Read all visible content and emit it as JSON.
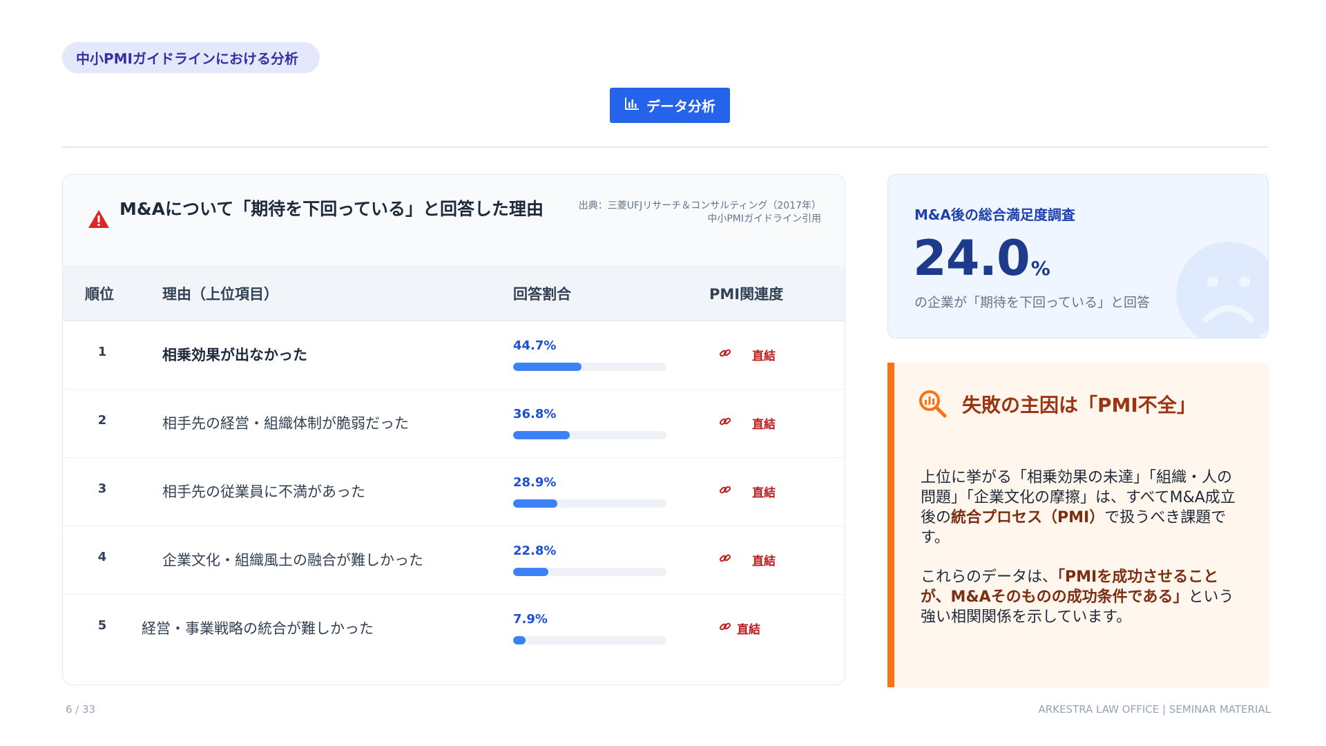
{
  "header": {
    "pill_label": "中小PMIガイドラインにおける分析",
    "badge_label": "データ分析",
    "badge_icon": "bar-chart-icon"
  },
  "table_card": {
    "title": "M&Aについて「期待を下回っている」と回答した理由",
    "source_line1": "出典：三菱UFJリサーチ＆コンサルティング（2017年）",
    "source_line2": "中小PMIガイドライン引用",
    "columns": [
      "順位",
      "理由（上位項目）",
      "回答割合",
      "PMI関連度"
    ],
    "rows": [
      {
        "rank": "1",
        "reason": "相乗効果が出なかった",
        "percent_label": "44.7%",
        "percent": 44.7,
        "relation": "直結"
      },
      {
        "rank": "2",
        "reason": "相手先の経営・組織体制が脆弱だった",
        "percent_label": "36.8%",
        "percent": 36.8,
        "relation": "直結"
      },
      {
        "rank": "3",
        "reason": "相手先の従業員に不満があった",
        "percent_label": "28.9%",
        "percent": 28.9,
        "relation": "直結"
      },
      {
        "rank": "4",
        "reason": "企業文化・組織風土の融合が難しかった",
        "percent_label": "22.8%",
        "percent": 22.8,
        "relation": "直結"
      },
      {
        "rank": "5",
        "reason": "経営・事業戦略の統合が難しかった",
        "percent_label": "7.9%",
        "percent": 7.9,
        "relation": "直結"
      }
    ]
  },
  "satisfaction": {
    "title": "M&A後の総合満足度調査",
    "value": "24.0",
    "unit": "%",
    "note": "の企業が「期待を下回っている」と回答"
  },
  "failure": {
    "title": "失敗の主因は「PMI不全」",
    "p1_a": "上位に挙がる「相乗効果の未達」「組織・人の問題」「企業文化の摩擦」は、すべてM&A成立後の",
    "p1_b": "統合プロセス（PMI）",
    "p1_c": "で扱うべき課題です。",
    "p2_a": "これらのデータは、",
    "p2_b": "「PMIを成功させることが、M&Aそのものの成功条件である」",
    "p2_c": "という強い相関関係を示しています。"
  },
  "footer": {
    "page": "6 / 33",
    "brand": "ARKESTRA LAW OFFICE | SEMINAR MATERIAL"
  },
  "colors": {
    "accent_blue": "#2563eb",
    "accent_orange": "#f97316",
    "danger_red": "#dc2626"
  }
}
